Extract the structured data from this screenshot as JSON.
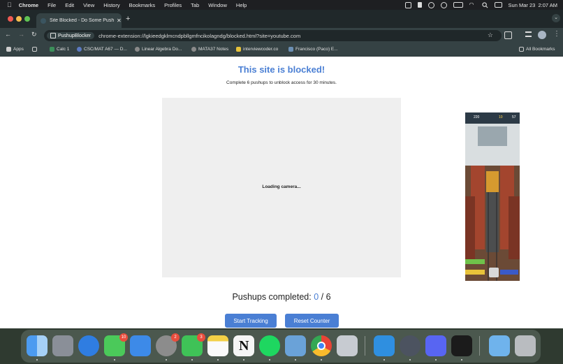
{
  "menubar": {
    "app": "Chrome",
    "items": [
      "File",
      "Edit",
      "View",
      "History",
      "Bookmarks",
      "Profiles",
      "Tab",
      "Window",
      "Help"
    ],
    "datetime": "Sun Mar 23  2:07 AM"
  },
  "tab": {
    "title": "Site Blocked - Do Some Push"
  },
  "address": {
    "chip": "PushupBlocker",
    "url": "chrome-extension://lgkieedgklmcndpbllgmfncikolagndg/blocked.html?site=youtube.com"
  },
  "bookmarks": {
    "items": [
      "Apps",
      "Calc 1",
      "CSC/MAT A67 — D...",
      "Linear Algebra Do...",
      "MATA37 Notes",
      "interviewcoder.co",
      "Francisco (Paco) E..."
    ],
    "all": "All Bookmarks"
  },
  "page": {
    "title": "This site is blocked!",
    "subtitle": "Complete 6 pushups to unblock access for 30 minutes.",
    "loading": "Loading camera...",
    "counter_label": "Pushups completed:",
    "count": "0",
    "separator": "/",
    "target": "6",
    "start_button": "Start Tracking",
    "reset_button": "Reset Counter"
  },
  "game_overlay": {
    "score": "220",
    "coins": "10",
    "stars": "57"
  },
  "dock": {
    "apps": [
      {
        "name": "finder"
      },
      {
        "name": "launchpad"
      },
      {
        "name": "safari"
      },
      {
        "name": "messages",
        "badge": "10"
      },
      {
        "name": "mail"
      },
      {
        "name": "system-settings",
        "badge": "2"
      },
      {
        "name": "facetime",
        "badge": "3"
      },
      {
        "name": "notes"
      },
      {
        "name": "notion"
      },
      {
        "name": "spotify"
      },
      {
        "name": "preview"
      },
      {
        "name": "chrome"
      },
      {
        "name": "iphone-mirroring"
      },
      {
        "name": "vscode"
      },
      {
        "name": "quicktime"
      },
      {
        "name": "discord"
      },
      {
        "name": "unity"
      },
      {
        "name": "downloads-folder"
      },
      {
        "name": "trash"
      }
    ]
  },
  "colors": {
    "accent": "#4a7fd4",
    "tabbar": "#20282a",
    "toolbar": "#354244"
  }
}
